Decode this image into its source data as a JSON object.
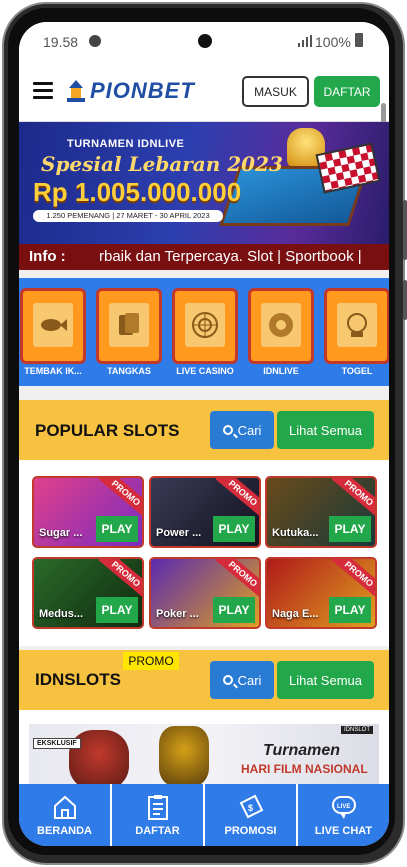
{
  "status": {
    "time": "19.58",
    "battery": "100%"
  },
  "header": {
    "brand": "PIONBET",
    "login_label": "MASUK",
    "register_label": "DAFTAR"
  },
  "banner": {
    "line1": "TURNAMEN IDNLIVE",
    "line2": "Spesial Lebaran 2023",
    "amount": "Rp 1.005.000.000",
    "sub": "1.250 PEMENANG | 27 MARET - 30 APRIL 2023"
  },
  "ticker": {
    "label": "Info :",
    "text": "rbaik dan Terpercaya. Slot | Sportbook |"
  },
  "categories": [
    {
      "label": "TEMBAK IK..."
    },
    {
      "label": "TANGKAS"
    },
    {
      "label": "LIVE CASINO"
    },
    {
      "label": "IDNLIVE"
    },
    {
      "label": "TOGEL"
    }
  ],
  "popular": {
    "title": "POPULAR SLOTS",
    "search_label": "Cari",
    "see_all_label": "Lihat Semua",
    "games": [
      {
        "name": "Sugar ...",
        "play": "PLAY",
        "badge": "PROMO",
        "color1": "#e0408a",
        "color2": "#7b2cbf"
      },
      {
        "name": "Power ...",
        "play": "PLAY",
        "badge": "PROMO",
        "color1": "#3a3a55",
        "color2": "#121220"
      },
      {
        "name": "Kutuka...",
        "play": "PLAY",
        "badge": "PROMO",
        "color1": "#6a4a1a",
        "color2": "#1a3a3a"
      },
      {
        "name": "Medus...",
        "play": "PLAY",
        "badge": "PROMO",
        "color1": "#2a6a2a",
        "color2": "#102a10"
      },
      {
        "name": "Poker ...",
        "play": "PLAY",
        "badge": "PROMO",
        "color1": "#5a2ab0",
        "color2": "#e0a020"
      },
      {
        "name": "Naga E...",
        "play": "PLAY",
        "badge": "PROMO",
        "color1": "#b01a1a",
        "color2": "#e0a020"
      }
    ]
  },
  "idnslots": {
    "title": "IDNSLOTS",
    "tag": "PROMO",
    "search_label": "Cari",
    "see_all_label": "Lihat Semua",
    "banner_badge": "EKSKLUSIF",
    "banner_logo": "IDNSLOT",
    "banner_title": "Turnamen",
    "banner_subtitle": "HARI FILM NASIONAL"
  },
  "nav": [
    {
      "label": "BERANDA",
      "icon": "home-icon"
    },
    {
      "label": "DAFTAR",
      "icon": "clipboard-icon"
    },
    {
      "label": "PROMOSI",
      "icon": "coupon-icon"
    },
    {
      "label": "LIVE CHAT",
      "icon": "live-chat-icon"
    }
  ]
}
